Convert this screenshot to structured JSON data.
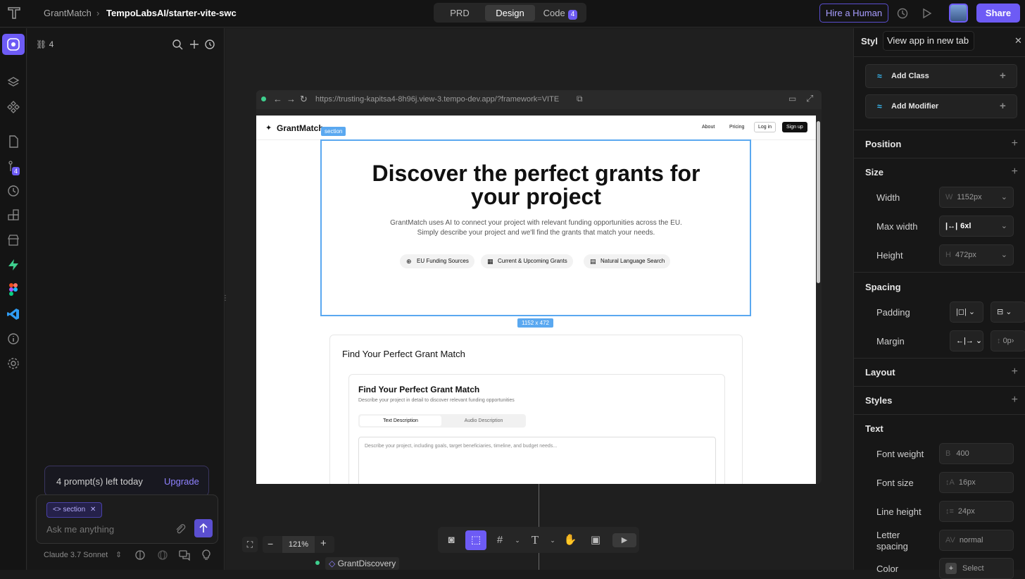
{
  "topbar": {
    "project": "GrantMatch",
    "repo": "TempoLabsAI/starter-vite-swc",
    "tabs": [
      "PRD",
      "Design",
      "Code"
    ],
    "code_badge": "4",
    "hire_label": "Hire a Human",
    "share_label": "Share"
  },
  "left": {
    "count": "4",
    "rail_badge": "4",
    "prompts_left": "4 prompt(s) left today",
    "upgrade": "Upgrade",
    "chip": "section",
    "placeholder": "Ask me anything",
    "model": "Claude 3.7 Sonnet"
  },
  "browser": {
    "url": "https://trusting-kapitsa4-8h96j.view-3.tempo-dev.app/?framework=VITE"
  },
  "site": {
    "logo": "GrantMatch",
    "nav": [
      "About",
      "Pricing",
      "Log in",
      "Sign up"
    ],
    "section_tag": "section",
    "size_tag": "1152 x 472",
    "hero_title": "Discover the perfect grants for your project",
    "hero_sub": "GrantMatch uses AI to connect your project with relevant funding opportunities across the EU. Simply describe your project and we'll find the grants that match your needs.",
    "chips": [
      "EU Funding Sources",
      "Current & Upcoming Grants",
      "Natural Language Search"
    ],
    "card_title": "Find Your Perfect Grant Match",
    "inner_title": "Find Your Perfect Grant Match",
    "inner_sub": "Describe your project in detail to discover relevant funding opportunities",
    "tabs": [
      "Text Description",
      "Audio Description"
    ],
    "textarea_placeholder": "Describe your project, including goals, target beneficiaries, timeline, and budget needs..."
  },
  "canvas": {
    "zoom": "121%",
    "component": "GrantDiscovery",
    "tooltip": "View app in new tab"
  },
  "right": {
    "header": "Styl",
    "add_class": "Add Class",
    "add_modifier": "Add Modifier",
    "position": "Position",
    "size": "Size",
    "width_label": "Width",
    "width_prefix": "W",
    "width_val": "1152px",
    "maxw_label": "Max width",
    "maxw_val": "6xl",
    "height_label": "Height",
    "height_prefix": "H",
    "height_val": "472px",
    "spacing": "Spacing",
    "padding_label": "Padding",
    "margin_label": "Margin",
    "margin_val": "0p›",
    "layout": "Layout",
    "styles": "Styles",
    "text": "Text",
    "fw_label": "Font weight",
    "fw_prefix": "B",
    "fw_val": "400",
    "fs_label": "Font size",
    "fs_val": "16px",
    "lh_label": "Line height",
    "lh_val": "24px",
    "ls_label_1": "Letter",
    "ls_label_2": "spacing",
    "ls_val": "normal",
    "color_label": "Color",
    "color_val": "Select"
  }
}
